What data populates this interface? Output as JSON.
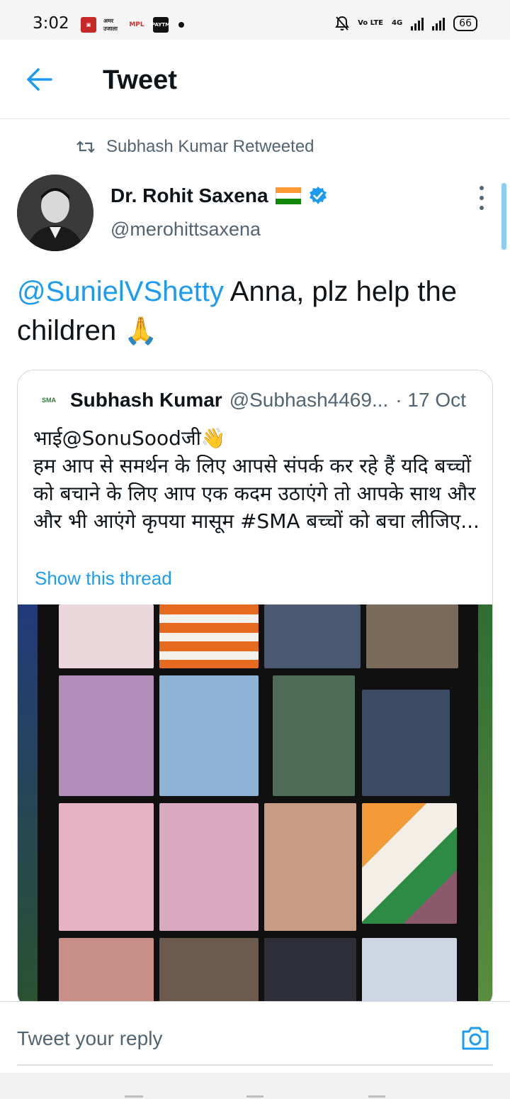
{
  "status_bar": {
    "time": "3:02",
    "notification_icons": [
      "news-app-icon",
      "amar-ujala-icon",
      "mpl-icon",
      "paytm-icon",
      "more-dot"
    ],
    "notification_texts": {
      "amar_ujala": "अमर उजाला",
      "mpl": "MPL",
      "paytm": "PAYTM"
    },
    "volte": "Vo LTE",
    "network": "4G",
    "battery": "66"
  },
  "app_bar": {
    "title": "Tweet",
    "back_icon": "arrow-left-icon"
  },
  "tweet": {
    "retweeted_by": "Subhash Kumar Retweeted",
    "author_name": "Dr. Rohit Saxena",
    "author_handle": "@merohittsaxena",
    "text_mention": "@SunielVShetty",
    "text_body": " Anna, plz help the children ",
    "text_emoji": "🙏"
  },
  "quoted_tweet": {
    "logo_text": "SMA",
    "author_name": "Subhash Kumar",
    "author_handle": "@Subhash4469...",
    "date": "· 17 Oct",
    "body_line1": "भाई@SonuSoodजी👋",
    "body_rest": "हम आप से समर्थन के लिए आपसे संपर्क कर रहे हैं यदि बच्चों को बचाने के लिए आप एक कदम उठाएंगे तो आपके साथ और और भी आएंगे  कृपया मासूम #SMA बच्चों को बचा लीजिए...",
    "show_thread": "Show this thread"
  },
  "reply": {
    "placeholder": "Tweet your reply",
    "camera_icon": "camera-icon"
  },
  "colors": {
    "accent": "#1d9bf0",
    "text": "#0f1419",
    "secondary": "#536471"
  }
}
